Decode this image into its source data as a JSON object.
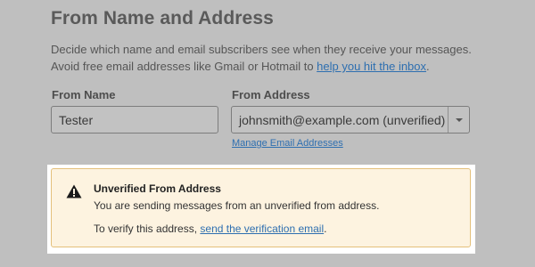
{
  "section": {
    "title": "From Name and Address",
    "description_line1": "Decide which name and email subscribers see when they receive your messages.",
    "description_line2_prefix": "Avoid free email addresses like Gmail or Hotmail to ",
    "description_link": "help you hit the inbox",
    "description_line2_suffix": "."
  },
  "from_name": {
    "label": "From Name",
    "value": "Tester"
  },
  "from_address": {
    "label": "From Address",
    "selected": "johnsmith@example.com (unverified)",
    "manage_link": "Manage Email Addresses"
  },
  "alert": {
    "icon": "warning-icon",
    "title": "Unverified From Address",
    "body": "You are sending messages from an unverified from address.",
    "verify_prefix": "To verify this address, ",
    "verify_link": "send the verification email",
    "verify_suffix": "."
  },
  "colors": {
    "link": "#2e6fb0",
    "alert_bg": "#fdf3e0",
    "alert_border": "#e4c07b",
    "overlay": "#bfbfbf"
  }
}
